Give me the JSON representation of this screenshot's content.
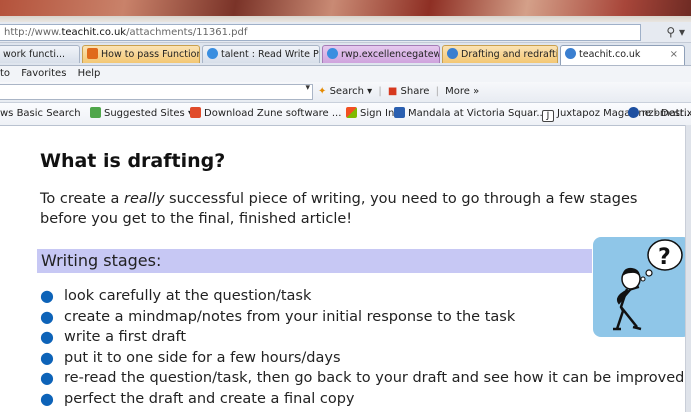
{
  "browser": {
    "address": {
      "prefix": "http://www.",
      "host": "teachit.co.uk",
      "path": "/attachments/11361.pdf"
    },
    "tabs": [
      {
        "label": "work functi...",
        "style": "plain",
        "icon_color": "#3a7fd0"
      },
      {
        "label": "How to pass Functional...",
        "style": "orange",
        "icon_color": "#e06a1b"
      },
      {
        "label": "talent : Read Write Plus...",
        "style": "plain",
        "icon_color": "#3a8ee0"
      },
      {
        "label": "rwp.excellencegateway...",
        "style": "plain",
        "icon_color": "#3a8ee0"
      },
      {
        "label": "Drafting and redrafting...",
        "style": "orange",
        "icon_color": "#3a7fd0"
      },
      {
        "label": "teachit.co.uk",
        "style": "active",
        "icon_color": "#3a7fd0",
        "close": "×"
      }
    ],
    "menu": [
      "to",
      "Favorites",
      "Help"
    ],
    "commands": {
      "search": "Search",
      "share": "Share",
      "more": "More",
      "more_glyph": "»"
    },
    "favorites": [
      {
        "label": "ws Basic Search",
        "icon_color": "#ffffff"
      },
      {
        "label": "Suggested Sites",
        "icon_color": "#4fa64a",
        "dropdown": "▾"
      },
      {
        "label": "Download Zune software ...",
        "icon_color": "#e04b2a"
      },
      {
        "label": "Sign In",
        "icon_color": "#f2a20c"
      },
      {
        "label": "Mandala at Victoria Squar...",
        "icon_color": "#2a5fb0"
      },
      {
        "label": "Juxtapoz Magazine - Dest...",
        "icon_color": "#222222"
      },
      {
        "label": "nzbmatrix",
        "icon_color": "#1d4fa0"
      }
    ]
  },
  "page": {
    "heading": "What is drafting?",
    "intro_before": "To create a ",
    "intro_emphasis": "really",
    "intro_after": " successful piece of writing, you need to go through a few stages before you get to the final, finished article!",
    "stages_title": "Writing stages:",
    "bullet_color": "#0d63b8",
    "stages_bar_color": "#c7c8f4",
    "steps": [
      "look carefully at the question/task",
      "create a mindmap/notes from your initial response to the task",
      "write a first draft",
      "put it to one side for a few hours/days",
      "re-read the question/task, then go back to your draft and see how it can be improved",
      "perfect the draft and create a final copy"
    ]
  }
}
